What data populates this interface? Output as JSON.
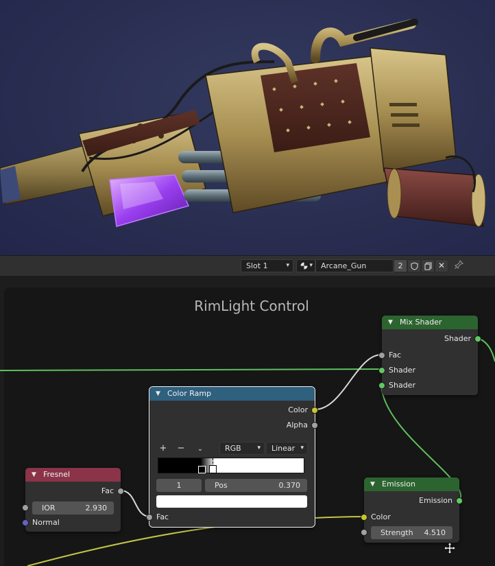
{
  "header": {
    "slot": "Slot 1",
    "material_name": "Arcane_Gun",
    "user_count": "2"
  },
  "frame": {
    "label": "RimLight Control"
  },
  "nodes": {
    "mix_shader": {
      "title": "Mix Shader",
      "out_shader": "Shader",
      "in_fac": "Fac",
      "in_shader1": "Shader",
      "in_shader2": "Shader"
    },
    "color_ramp": {
      "title": "Color Ramp",
      "out_color": "Color",
      "out_alpha": "Alpha",
      "add": "+",
      "remove": "−",
      "color_mode": "RGB",
      "interpolation": "Linear",
      "stop_index": "1",
      "pos_label": "Pos",
      "pos_value": "0.370",
      "in_fac": "Fac"
    },
    "fresnel": {
      "title": "Fresnel",
      "out_fac": "Fac",
      "ior_label": "IOR",
      "ior_value": "2.930",
      "in_normal": "Normal"
    },
    "emission": {
      "title": "Emission",
      "out_emission": "Emission",
      "in_color": "Color",
      "strength_label": "Strength",
      "strength_value": "4.510"
    }
  },
  "colors": {
    "header_blue": "#2f607e",
    "header_green": "#2c6430",
    "header_red": "#8b3349",
    "socket_yellow": "#c7c729",
    "socket_green": "#63c763",
    "socket_gray": "#a1a1a1",
    "socket_purple": "#6363c7",
    "wire_green": "#5fc15f",
    "wire_yellow": "#c4c44a",
    "wire_white": "#d8d8d8"
  }
}
